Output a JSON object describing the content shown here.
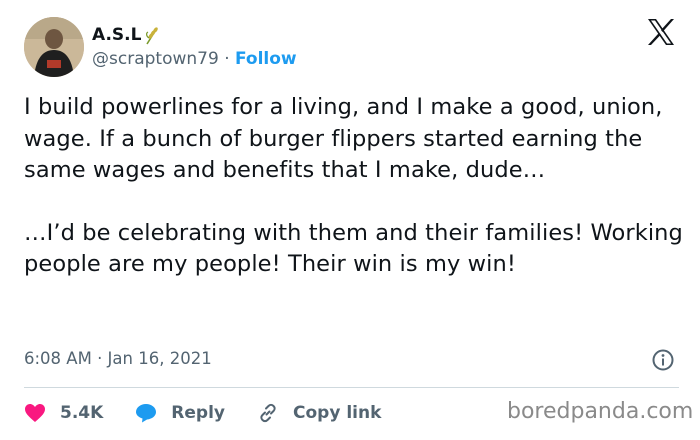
{
  "author": {
    "name": "A.S.L",
    "handle": "@scraptown79",
    "separator": "·",
    "follow_label": "Follow",
    "name_emoji": "wheat-sheaf-emoji"
  },
  "tweet": {
    "paragraph1": "I build powerlines for a living, and I make a good, union, wage. If a bunch of burger flippers started earning the same wages and benefits that I make, dude…",
    "paragraph2": "…I’d be celebrating with them and their families! Working people are my people! Their win is my win!"
  },
  "timestamp": "6:08 AM · Jan 16, 2021",
  "actions": {
    "likes": "5.4K",
    "reply_label": "Reply",
    "copy_link_label": "Copy link"
  },
  "watermark": "boredpanda.com",
  "colors": {
    "text": "#0f1419",
    "muted": "#536471",
    "accent": "#1d9bf0",
    "like": "#f91880"
  }
}
